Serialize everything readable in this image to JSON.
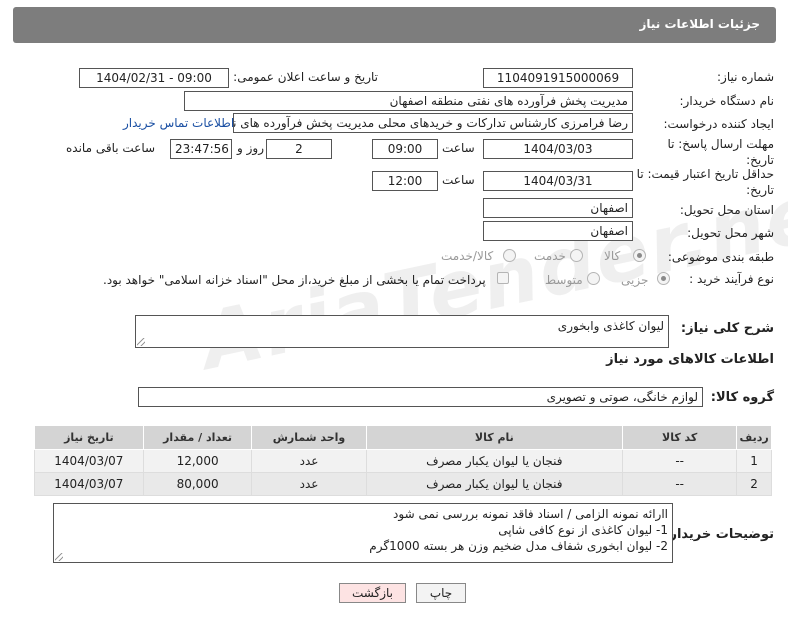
{
  "header": {
    "title": "جزئیات اطلاعات نیاز"
  },
  "form": {
    "need_number_label": "شماره نیاز:",
    "need_number": "1104091915000069",
    "announce_label": "تاریخ و ساعت اعلان عمومی:",
    "announce_value": "1404/02/31 - 09:00",
    "buyer_org_label": "نام دستگاه خریدار:",
    "buyer_org": "مدیریت پخش فرآورده های نفتی منطقه اصفهان",
    "creator_label": "ایجاد کننده درخواست:",
    "creator": "رضا فرامرزی کارشناس تدارکات و خریدهای محلی مدیریت پخش فرآورده های نفتی",
    "contact_link": "اطلاعات تماس خریدار",
    "deadline_label": "مهلت ارسال پاسخ: تا تاریخ:",
    "deadline_date": "1404/03/03",
    "time_word": "ساعت",
    "deadline_time": "09:00",
    "days_count": "2",
    "days_word": "روز و",
    "remaining_time": "23:47:56",
    "remaining_word": "ساعت باقی مانده",
    "price_validity_label": "حداقل تاریخ اعتبار قیمت: تا تاریخ:",
    "price_validity_date": "1404/03/31",
    "price_validity_time": "12:00",
    "province_label": "استان محل تحویل:",
    "province": "اصفهان",
    "city_label": "شهر محل تحویل:",
    "city": "اصفهان",
    "category_label": "طبقه بندی موضوعی:",
    "category_options": [
      "کالا",
      "خدمت",
      "کالا/خدمت"
    ],
    "process_label": "نوع فرآیند خرید :",
    "process_options": [
      "جزیی",
      "متوسط"
    ],
    "payment_note": "پرداخت تمام یا بخشی از مبلغ خرید،از محل \"اسناد خزانه اسلامی\" خواهد بود."
  },
  "description": {
    "label": "شرح کلی نیاز:",
    "value": "لیوان کاغذی وابخوری"
  },
  "goods_info_title": "اطلاعات کالاهای مورد نیاز",
  "goods_group": {
    "label": "گروه کالا:",
    "value": "لوازم خانگی، صوتی و تصویری"
  },
  "table": {
    "headers": [
      "ردیف",
      "کد کالا",
      "نام کالا",
      "واحد شمارش",
      "تعداد / مقدار",
      "تاریخ نیاز"
    ],
    "rows": [
      [
        "1",
        "--",
        "فنجان یا لیوان یکبار مصرف",
        "عدد",
        "12,000",
        "1404/03/07"
      ],
      [
        "2",
        "--",
        "فنجان یا لیوان یکبار مصرف",
        "عدد",
        "80,000",
        "1404/03/07"
      ]
    ]
  },
  "buyer_notes": {
    "label": "توضیحات خریدار:",
    "lines": [
      "اارائه نمونه الزامی / اسناد فاقد نمونه بررسی نمی شود",
      "1- لیوان کاغذی از نوع کافی شاپی",
      "2- لیوان ابخوری شفاف مدل ضخیم وزن هر بسته 1000گرم"
    ]
  },
  "buttons": {
    "print": "چاپ",
    "back": "بازگشت"
  },
  "watermark": "AriaTender.neT",
  "colors": {
    "header_bg": "#7d7d7d",
    "link": "#1a4fa3",
    "back_btn_bg": "#fde3e3"
  }
}
